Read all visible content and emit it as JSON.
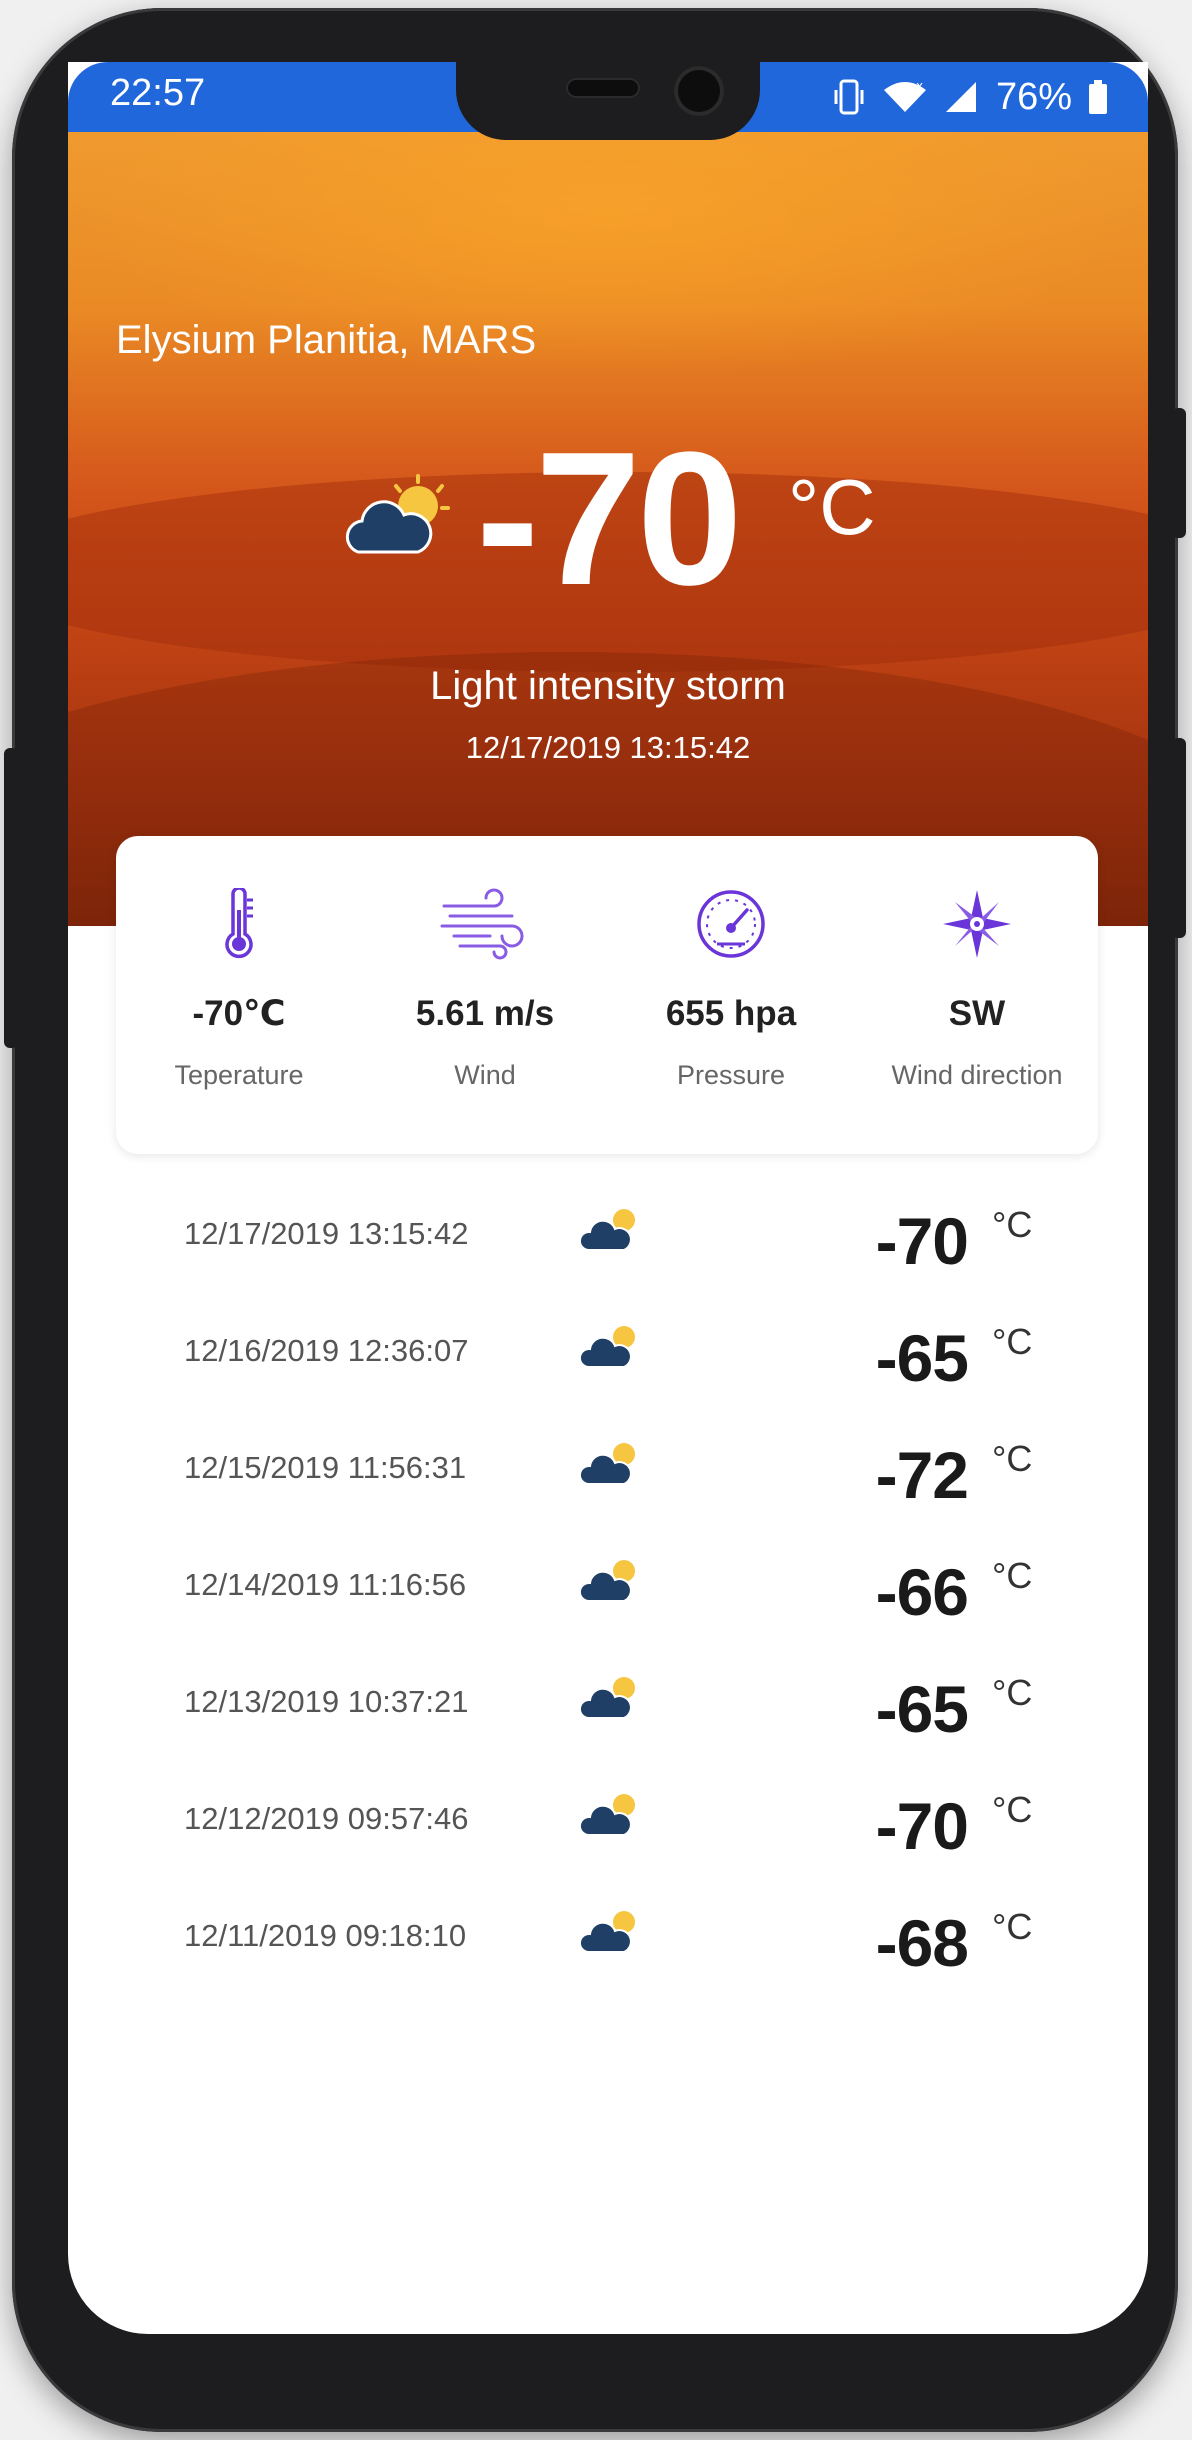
{
  "status_bar": {
    "time": "22:57",
    "battery_percent": "76%",
    "icons": [
      "vibrate-icon",
      "wifi-icon",
      "cellular-signal-icon",
      "battery-icon"
    ]
  },
  "hero": {
    "location": "Elysium Planitia, MARS",
    "icon": "partly-cloudy-icon",
    "temperature": "-70",
    "unit": "°C",
    "condition": "Light intensity storm",
    "timestamp": "12/17/2019 13:15:42"
  },
  "stats": [
    {
      "icon": "thermometer-icon",
      "value": "-70℃",
      "label": "Teperature"
    },
    {
      "icon": "wind-icon",
      "value": "5.61 m/s",
      "label": "Wind"
    },
    {
      "icon": "gauge-icon",
      "value": "655 hpa",
      "label": "Pressure"
    },
    {
      "icon": "compass-icon",
      "value": "SW",
      "label": "Wind direction"
    }
  ],
  "history": [
    {
      "date": "12/17/2019 13:15:42",
      "temp": "-70",
      "unit": "°C",
      "icon": "partly-cloudy-icon"
    },
    {
      "date": "12/16/2019 12:36:07",
      "temp": "-65",
      "unit": "°C",
      "icon": "partly-cloudy-icon"
    },
    {
      "date": "12/15/2019 11:56:31",
      "temp": "-72",
      "unit": "°C",
      "icon": "partly-cloudy-icon"
    },
    {
      "date": "12/14/2019 11:16:56",
      "temp": "-66",
      "unit": "°C",
      "icon": "partly-cloudy-icon"
    },
    {
      "date": "12/13/2019 10:37:21",
      "temp": "-65",
      "unit": "°C",
      "icon": "partly-cloudy-icon"
    },
    {
      "date": "12/12/2019 09:57:46",
      "temp": "-70",
      "unit": "°C",
      "icon": "partly-cloudy-icon"
    },
    {
      "date": "12/11/2019 09:18:10",
      "temp": "-68",
      "unit": "°C",
      "icon": "partly-cloudy-icon"
    }
  ],
  "colors": {
    "status_bar": "#2067db",
    "accent_purple": "#6a35d9",
    "cloud": "#1f3f66",
    "sun": "#f6c640"
  }
}
